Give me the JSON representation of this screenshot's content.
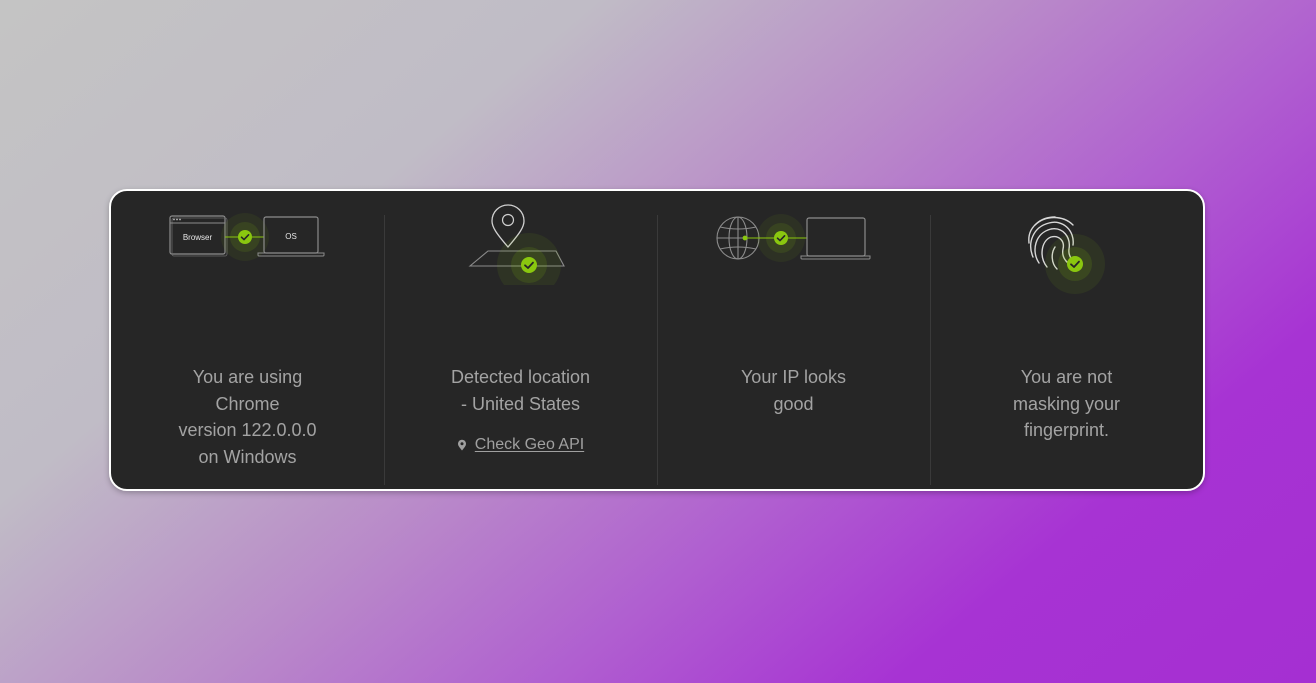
{
  "panels": [
    {
      "icon": "browser-os-check-icon",
      "icon_labels": {
        "browser": "Browser",
        "os": "OS"
      },
      "lines": [
        "You are using",
        "Chrome",
        "version 122.0.0.0",
        "on Windows"
      ]
    },
    {
      "icon": "location-check-icon",
      "lines": [
        "Detected location",
        "- United States"
      ],
      "link": {
        "icon": "location-pin-icon",
        "label": "Check Geo API"
      }
    },
    {
      "icon": "ip-globe-check-icon",
      "lines": [
        "Your IP looks",
        "good"
      ]
    },
    {
      "icon": "fingerprint-check-icon",
      "lines": [
        "You are not",
        "masking your",
        "fingerprint."
      ]
    }
  ],
  "colors": {
    "card_bg": "#262626",
    "text": "#a3a3a3",
    "accent_green": "#8ac70f",
    "divider": "#3a3a3a"
  }
}
